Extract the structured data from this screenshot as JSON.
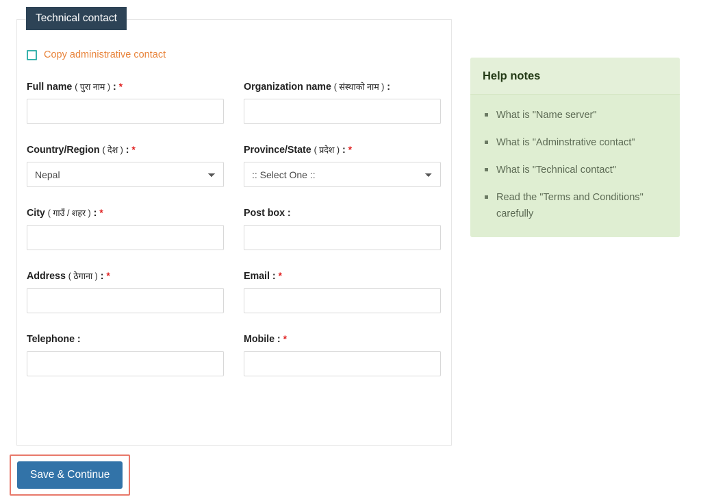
{
  "card": {
    "tab_title": "Technical contact",
    "copy_checkbox_label": "Copy administrative contact"
  },
  "fields": {
    "full_name": {
      "label_en": "Full name",
      "label_np": "( पुरा नाम )",
      "colon": ":",
      "required_mark": "*",
      "value": "",
      "placeholder": ""
    },
    "organization_name": {
      "label_en": "Organization name",
      "label_np": "( संस्थाको नाम )",
      "colon": ":",
      "required_mark": "",
      "value": "",
      "placeholder": ""
    },
    "country_region": {
      "label_en": "Country/Region",
      "label_np": "( देश )",
      "colon": ":",
      "required_mark": "*",
      "selected": "Nepal",
      "options": [
        "Nepal"
      ]
    },
    "province_state": {
      "label_en": "Province/State",
      "label_np": "( प्रदेश )",
      "colon": ":",
      "required_mark": "*",
      "selected": ":: Select One ::",
      "options": [
        ":: Select One ::"
      ]
    },
    "city": {
      "label_en": "City",
      "label_np": "( गाउँ / शहर )",
      "colon": ":",
      "required_mark": "*",
      "value": "",
      "placeholder": ""
    },
    "post_box": {
      "label_en": "Post box",
      "label_np": "",
      "colon": ":",
      "required_mark": "",
      "value": "",
      "placeholder": ""
    },
    "address": {
      "label_en": "Address",
      "label_np": "( ठेगाना )",
      "colon": ":",
      "required_mark": "*",
      "value": "",
      "placeholder": ""
    },
    "email": {
      "label_en": "Email",
      "label_np": "",
      "colon": ":",
      "required_mark": "*",
      "value": "",
      "placeholder": ""
    },
    "telephone": {
      "label_en": "Telephone",
      "label_np": "",
      "colon": ":",
      "required_mark": "",
      "value": "",
      "placeholder": ""
    },
    "mobile": {
      "label_en": "Mobile",
      "label_np": "",
      "colon": ":",
      "required_mark": "*",
      "value": "",
      "placeholder": ""
    }
  },
  "actions": {
    "save_continue_label": "Save & Continue"
  },
  "help": {
    "title": "Help notes",
    "notes": [
      "What is \"Name server\"",
      "What is \"Adminstrative contact\"",
      "What is \"Technical contact\"",
      "Read the \"Terms and Conditions\" carefully"
    ]
  },
  "colors": {
    "header_bar": "#2d4356",
    "accent_orange": "#e8833a",
    "checkbox_teal": "#38b2ac",
    "required_red": "#e02020",
    "button_blue": "#3273a8",
    "highlight_outline": "#e8786a",
    "help_bg": "#dfeed2",
    "help_head_bg": "#e4f0d9",
    "help_title": "#243b17"
  }
}
